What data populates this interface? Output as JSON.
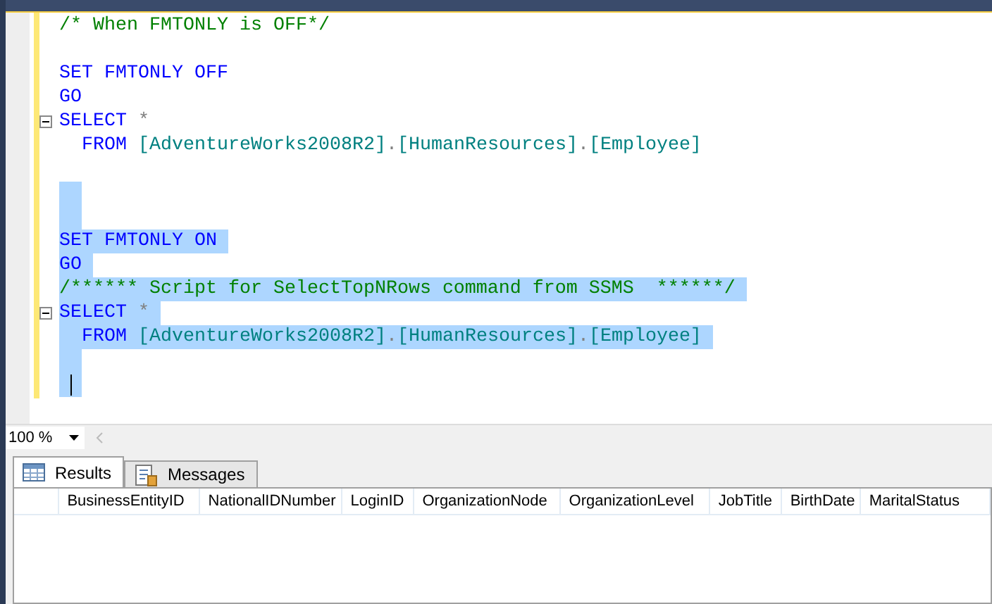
{
  "editor": {
    "lines": [
      {
        "selected": false,
        "fold": false,
        "segments": [
          {
            "kind": "comment",
            "text": "/* When FMTONLY is OFF*/"
          }
        ]
      },
      {
        "selected": false,
        "fold": false
      },
      {
        "selected": false,
        "fold": false,
        "segments": [
          {
            "kind": "keyword",
            "text": "SET FMTONLY OFF"
          }
        ]
      },
      {
        "selected": false,
        "fold": false,
        "segments": [
          {
            "kind": "keyword",
            "text": "GO"
          }
        ]
      },
      {
        "selected": false,
        "fold": true,
        "segments": [
          {
            "kind": "keyword",
            "text": "SELECT"
          },
          {
            "kind": "operator",
            "text": " *"
          }
        ]
      },
      {
        "selected": false,
        "fold": false,
        "segments": [
          {
            "kind": "keyword",
            "text": "  FROM"
          },
          {
            "kind": "identifier",
            "text": " [AdventureWorks2008R2]"
          },
          {
            "kind": "operator",
            "text": "."
          },
          {
            "kind": "identifier",
            "text": "[HumanResources]"
          },
          {
            "kind": "operator",
            "text": "."
          },
          {
            "kind": "identifier",
            "text": "[Employee]"
          }
        ]
      },
      {
        "selected": false,
        "fold": false
      },
      {
        "selected": true,
        "fold": false
      },
      {
        "selected": true,
        "fold": false
      },
      {
        "selected": true,
        "fold": false,
        "segments": [
          {
            "kind": "keyword",
            "text": "SET FMTONLY ON"
          }
        ]
      },
      {
        "selected": true,
        "fold": false,
        "segments": [
          {
            "kind": "keyword",
            "text": "GO"
          }
        ]
      },
      {
        "selected": true,
        "fold": false,
        "segments": [
          {
            "kind": "comment",
            "text": "/****** Script for SelectTopNRows command from SSMS  ******/"
          }
        ]
      },
      {
        "selected": true,
        "fold": true,
        "segments": [
          {
            "kind": "keyword",
            "text": "SELECT"
          },
          {
            "kind": "operator",
            "text": " *"
          }
        ]
      },
      {
        "selected": true,
        "fold": false,
        "segments": [
          {
            "kind": "keyword",
            "text": "  FROM"
          },
          {
            "kind": "identifier",
            "text": " [AdventureWorks2008R2]"
          },
          {
            "kind": "operator",
            "text": "."
          },
          {
            "kind": "identifier",
            "text": "[HumanResources]"
          },
          {
            "kind": "operator",
            "text": "."
          },
          {
            "kind": "identifier",
            "text": "[Employee]"
          }
        ]
      },
      {
        "selected": true,
        "fold": false
      },
      {
        "selected": true,
        "fold": false,
        "caret": true
      }
    ]
  },
  "zoom": {
    "value": "100 %"
  },
  "tabs": [
    {
      "label": "Results",
      "selected": true,
      "kind": "grid"
    },
    {
      "label": "Messages",
      "selected": false,
      "kind": "messages"
    }
  ],
  "grid": {
    "columns": [
      "BusinessEntityID",
      "NationalIDNumber",
      "LoginID",
      "OrganizationNode",
      "OrganizationLevel",
      "JobTitle",
      "BirthDate",
      "MaritalStatus"
    ]
  }
}
